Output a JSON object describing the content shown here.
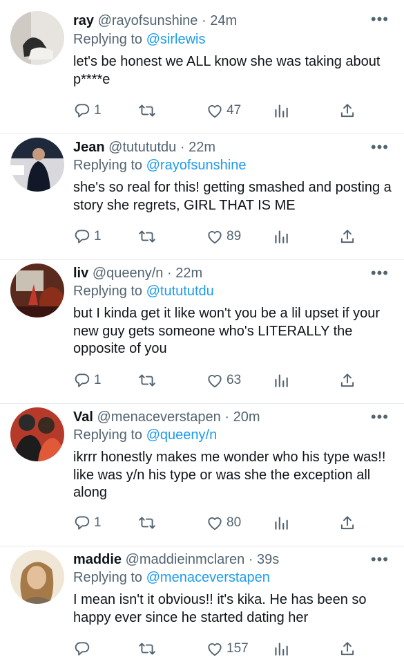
{
  "tweets": [
    {
      "name": "ray",
      "handle": "@rayofsunshine",
      "time": "24m",
      "reply_prefix": "Replying to",
      "reply_to": "@sirlewis",
      "text": "let's be honest we ALL know she was taking about p****e",
      "replies": "1",
      "likes": "47"
    },
    {
      "name": "Jean",
      "handle": "@tutututdu",
      "time": "22m",
      "reply_prefix": "Replying to",
      "reply_to": "@rayofsunshine",
      "text": "she's so real for this! getting smashed and posting a story she regrets, GIRL THAT IS ME",
      "replies": "1",
      "likes": "89"
    },
    {
      "name": "liv",
      "handle": "@queeny/n",
      "time": "22m",
      "reply_prefix": "Replying to",
      "reply_to": "@tutututdu",
      "text": "but I kinda get it like won't you be a lil upset if your new guy gets someone who's LITERALLY the opposite of you",
      "replies": "1",
      "likes": "63"
    },
    {
      "name": "Val",
      "handle": "@menaceverstapen",
      "time": "20m",
      "reply_prefix": "Replying to",
      "reply_to": "@queeny/n",
      "text": "ikrrr honestly makes me wonder who his type was!! like was y/n his type or was she the exception all along",
      "replies": "1",
      "likes": "80"
    },
    {
      "name": "maddie",
      "handle": "@maddieinmclaren",
      "time": "39s",
      "reply_prefix": "Replying to",
      "reply_to": "@menaceverstapen",
      "text": "I mean isn't it obvious!! it's kika. He has been so happy ever since he started dating her",
      "replies": "",
      "likes": "157"
    }
  ],
  "separator": "·",
  "more_glyph": "•••",
  "colors": {
    "link": "#1d9bf0",
    "secondary": "#536471",
    "text": "#0f1419",
    "divider": "#e6e9eb"
  },
  "icons": [
    "reply-icon",
    "retweet-icon",
    "like-icon",
    "stats-icon",
    "share-icon",
    "more-icon"
  ]
}
